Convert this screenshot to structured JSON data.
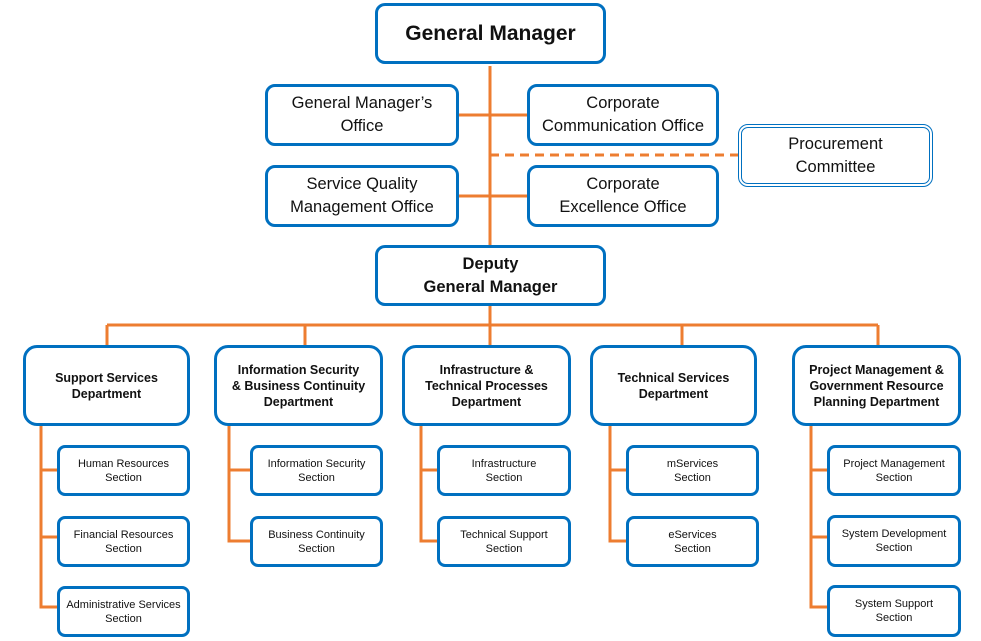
{
  "colors": {
    "box_border": "#0070C0",
    "connector": "#ED7D31",
    "background": "#FFFFFF"
  },
  "general_manager": "General Manager",
  "offices": {
    "gm_office": "General Manager’s\nOffice",
    "corporate_communication": "Corporate\nCommunication Office",
    "procurement_committee": "Procurement\nCommittee",
    "service_quality": "Service Quality\nManagement Office",
    "corporate_excellence": "Corporate\nExcellence Office"
  },
  "deputy_general_manager": "Deputy\nGeneral Manager",
  "departments": [
    {
      "name": "Support Services\nDepartment",
      "sections": [
        "Human Resources\nSection",
        "Financial Resources\nSection",
        "Administrative Services\nSection"
      ]
    },
    {
      "name": "Information Security\n& Business Continuity\nDepartment",
      "sections": [
        "Information Security\nSection",
        "Business Continuity\nSection"
      ]
    },
    {
      "name": "Infrastructure &\nTechnical Processes\nDepartment",
      "sections": [
        "Infrastructure\nSection",
        "Technical Support\nSection"
      ]
    },
    {
      "name": "Technical Services\nDepartment",
      "sections": [
        "mServices\nSection",
        "eServices\nSection"
      ]
    },
    {
      "name": "Project Management &\nGovernment Resource\nPlanning Department",
      "sections": [
        "Project Management\nSection",
        "System Development\nSection",
        "System Support\nSection"
      ]
    }
  ]
}
